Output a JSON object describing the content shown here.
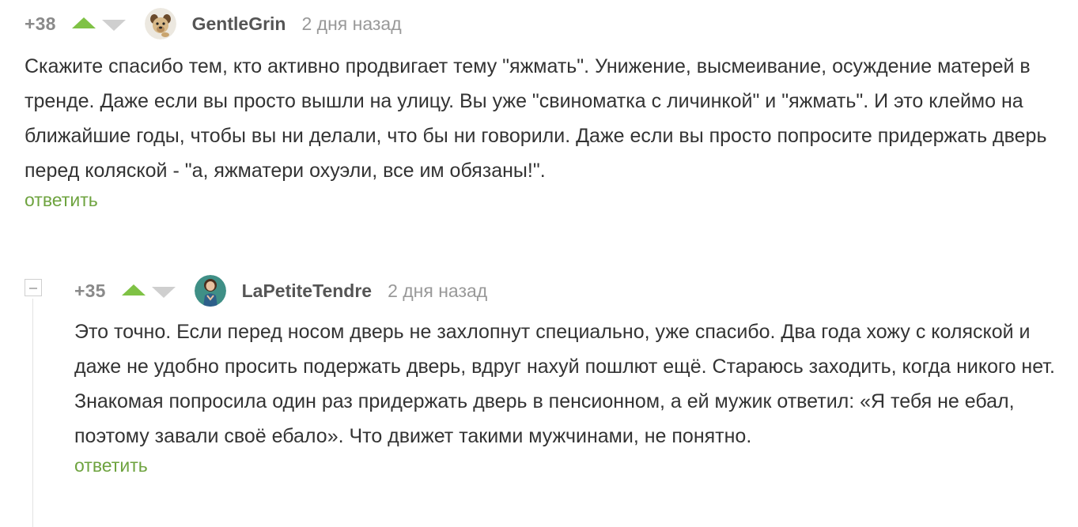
{
  "comments": [
    {
      "rating": "+38",
      "username": "GentleGrin",
      "time": "2 дня назад",
      "avatar_icon": "dog-avatar-icon",
      "paragraphs": [
        "Скажите спасибо тем, кто активно продвигает тему \"яжмать\". Унижение, высмеивание, осуждение матерей в тренде. Даже если вы просто вышли на улицу. Вы уже \"свиноматка с личинкой\" и \"яжмать\". И это клеймо на ближайшие годы, чтобы вы ни делали, что бы ни говорили. Даже если вы просто попросите придержать дверь перед коляской - \"а, яжматери охуэли, все им обязаны!\"."
      ],
      "reply_label": "ответить"
    },
    {
      "rating": "+35",
      "username": "LaPetiteTendre",
      "time": "2 дня назад",
      "avatar_icon": "woman-avatar-icon",
      "paragraphs": [
        "Это точно. Если перед носом дверь не захлопнут специально, уже спасибо. Два года хожу с коляской и даже не удобно просить подержать дверь, вдруг нахуй пошлют ещё. Стараюсь заходить, когда никого нет.",
        "Знакомая попросила один раз придержать дверь в пенсионном, а ей мужик ответил: «Я тебя не ебал, поэтому завали своё ебало». Что движет такими мужчинами, не понятно."
      ],
      "reply_label": "ответить"
    }
  ],
  "colors": {
    "upvote": "#7fc245",
    "downvote": "#cfcfcf",
    "reply_link": "#6ea33f",
    "meta_text": "#999999"
  }
}
